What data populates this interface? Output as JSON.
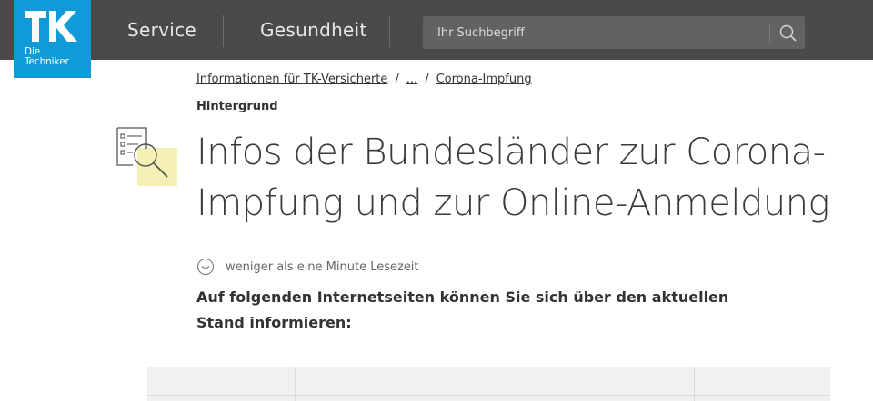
{
  "logo": {
    "line1": "Die",
    "line2": "Techniker",
    "brand_color": "#0f9bd7"
  },
  "nav": {
    "items": [
      {
        "label": "Service"
      },
      {
        "label": "Gesundheit"
      }
    ]
  },
  "search": {
    "placeholder": "Ihr Suchbegriff",
    "icon": "search-icon"
  },
  "breadcrumb": [
    {
      "label": "Informationen für TK-Versicherte"
    },
    {
      "label": "..."
    },
    {
      "label": "Corona-Impfung"
    }
  ],
  "article": {
    "category": "Hintergrund",
    "icon": "checklist-magnifier-icon",
    "title": "Infos der Bundesländer zur Corona-Impfung und zur Online-Anmeldung",
    "reading_time": "weniger als eine Minute Lesezeit",
    "intro": "Auf folgenden Internetseiten können Sie sich über den aktuellen Stand informieren:"
  },
  "colors": {
    "header_bg": "#4a4a4a",
    "accent_yellow": "#f5f0b3"
  }
}
